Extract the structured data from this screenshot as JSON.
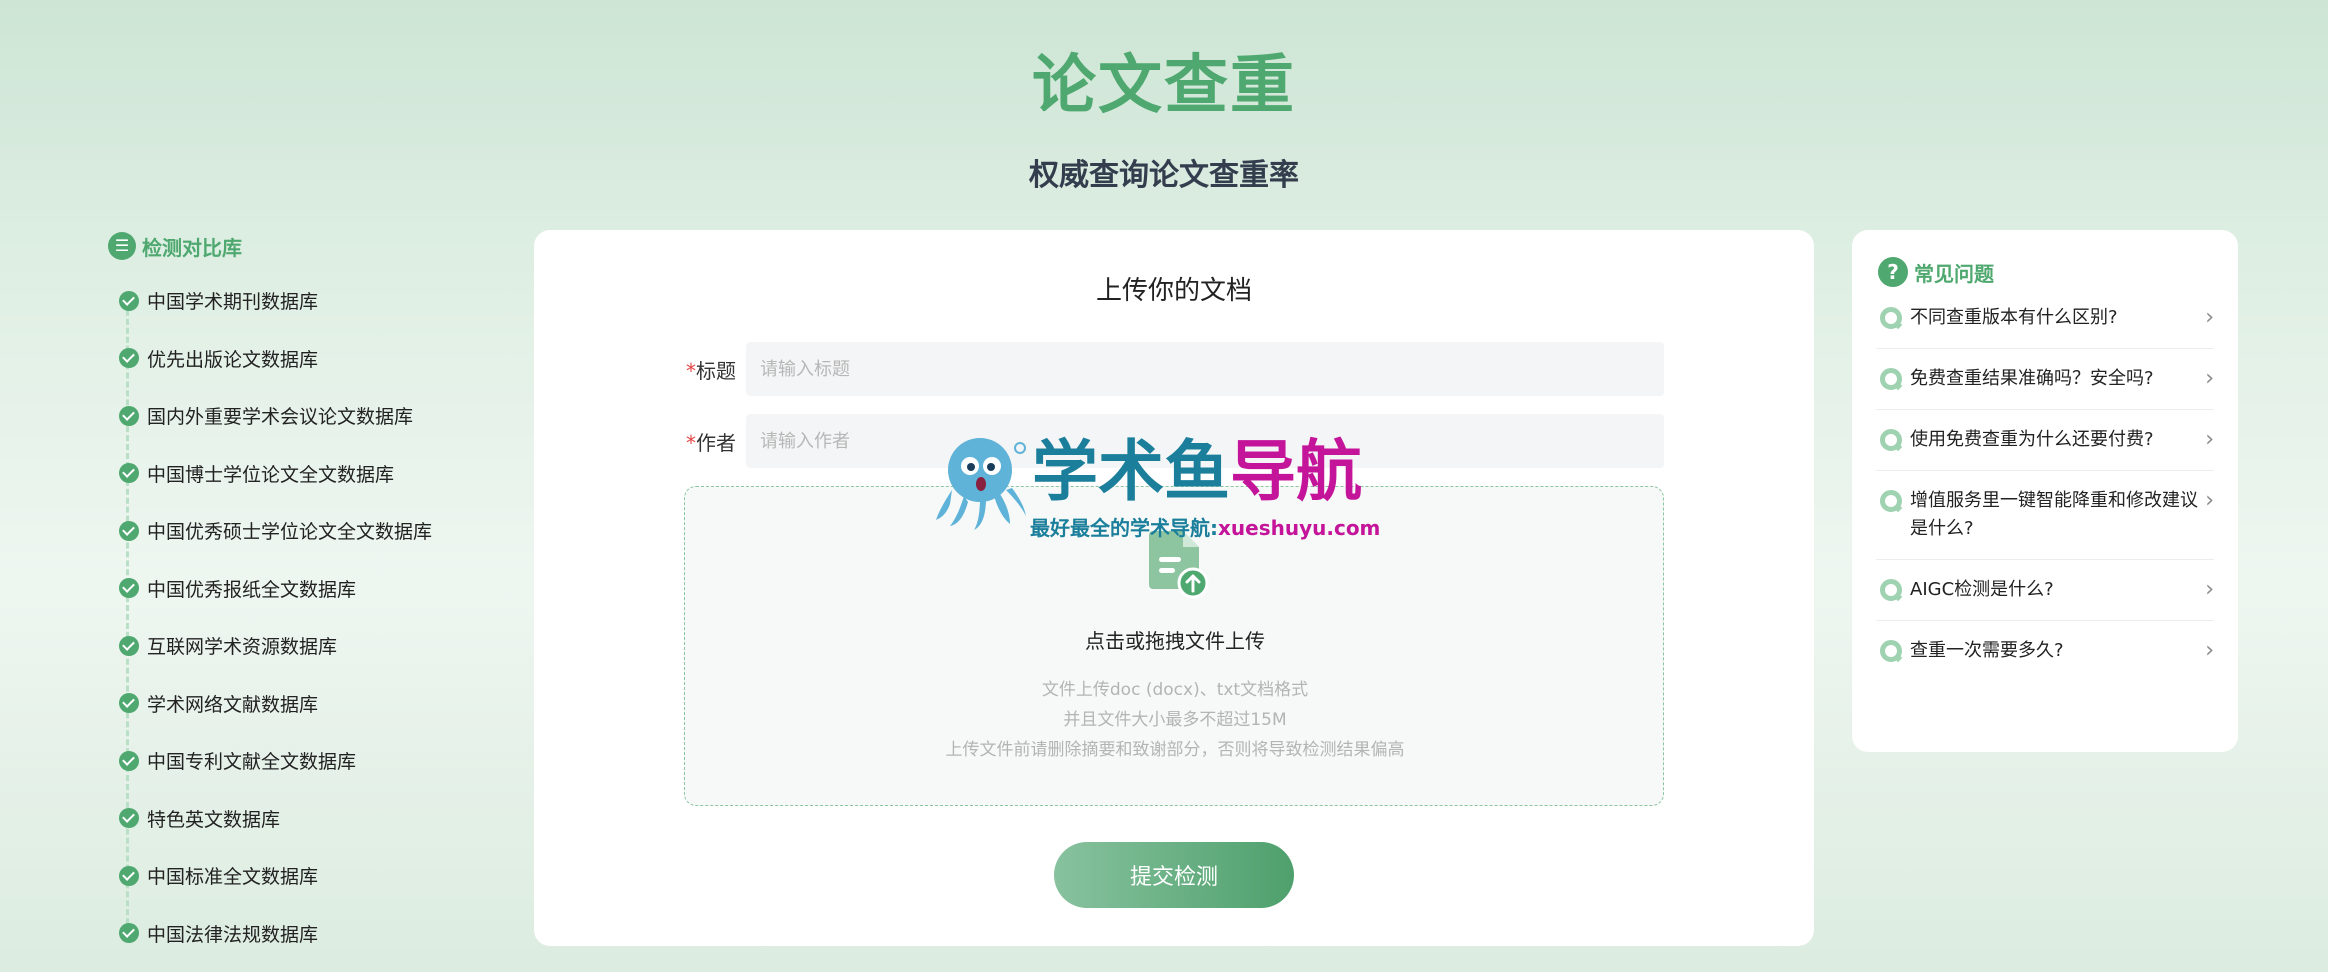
{
  "hero": {
    "title": "论文查重",
    "subtitle": "权威查询论文查重率"
  },
  "database": {
    "title": "检测对比库",
    "items": [
      "中国学术期刊数据库",
      "优先出版论文数据库",
      "国内外重要学术会议论文数据库",
      "中国博士学位论文全文数据库",
      "中国优秀硕士学位论文全文数据库",
      "中国优秀报纸全文数据库",
      "互联网学术资源数据库",
      "学术网络文献数据库",
      "中国专利文献全文数据库",
      "特色英文数据库",
      "中国标准全文数据库",
      "中国法律法规数据库"
    ]
  },
  "upload": {
    "title": "上传你的文档",
    "required_mark": "*",
    "title_label": "标题",
    "title_placeholder": "请输入标题",
    "author_label": "作者",
    "author_placeholder": "请输入作者",
    "drop_text": "点击或拖拽文件上传",
    "hint_1": "文件上传doc (docx)、txt文档格式",
    "hint_2": "并且文件大小最多不超过15M",
    "hint_3": "上传文件前请删除摘要和致谢部分，否则将导致检测结果偏高",
    "submit_label": "提交检测"
  },
  "watermark": {
    "brand_a": "学术鱼",
    "brand_b": "导航",
    "tagline": "最好最全的学术导航:",
    "url": "xueshuyu.com"
  },
  "faq": {
    "title": "常见问题",
    "items": [
      "不同查重版本有什么区别?",
      "免费查重结果准确吗？安全吗?",
      "使用免费查重为什么还要付费?",
      "增值服务里一键智能降重和修改建议是什么?",
      "AIGC检测是什么?",
      "查重一次需要多久?"
    ]
  },
  "colors": {
    "accent": "#4fa86f",
    "brand_blue": "#1b7f9b",
    "brand_magenta": "#c4159a",
    "required": "#e54545"
  }
}
